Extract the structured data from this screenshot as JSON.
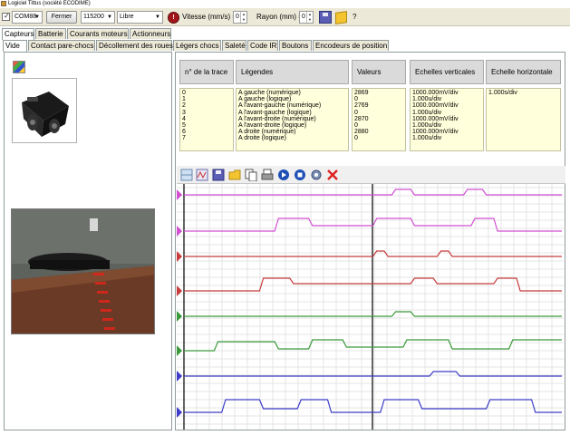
{
  "window": {
    "title": "Logiciel Tittus (société ECODIME)"
  },
  "toolbar": {
    "port": "COM88",
    "close_label": "Fermer",
    "baud": "115200",
    "mode": "Libre",
    "stop_label": "!",
    "speed_label": "Vitesse (mm/s) =",
    "speed_value": "0",
    "radius_label": "Rayon (mm) =",
    "radius_value": "0",
    "help_label": "?"
  },
  "main_tabs": [
    "Capteurs",
    "Batterie",
    "Courants moteurs",
    "Actionneurs"
  ],
  "sub_tabs": [
    "Vide",
    "Contact pare-chocs",
    "Décollement des roues",
    "Légers chocs",
    "Saleté",
    "Code IR",
    "Boutons",
    "Encodeurs de position"
  ],
  "table": {
    "headers": [
      "n° de la trace",
      "Légendes",
      "Valeurs",
      "Echelles verticales",
      "Echelle horizontale"
    ],
    "indices": [
      "0",
      "1",
      "2",
      "3",
      "4",
      "5",
      "6",
      "7"
    ],
    "legends": [
      "A gauche (numérique)",
      "A gauche (logique)",
      "A l'avant-gauche (numérique)",
      "A l'avant-gauche (logique)",
      "A l'avant-droite (numérique)",
      "A l'avant-droite (logique)",
      "A droite (numérique)",
      "A droite (logique)"
    ],
    "values": [
      "2869",
      "0",
      "2769",
      "0",
      "2870",
      "0",
      "2880",
      "0"
    ],
    "vertical_scales": [
      "1000.000mV/div",
      "1.000u/div",
      "1000.000mV/div",
      "1.000u/div",
      "1000.000mV/div",
      "1.000u/div",
      "1000.000mV/div",
      "1.000u/div"
    ],
    "horizontal_scale": "1.000s/div"
  },
  "trace_colors": [
    "#d24fd2",
    "#d24fd2",
    "#c83c3c",
    "#c83c3c",
    "#3a9a3a",
    "#3a9a3a",
    "#3c3cc8",
    "#3c3cc8"
  ],
  "chart_tools": [
    "view-icon",
    "wave-icon",
    "save-icon",
    "open-icon",
    "copy-icon",
    "print-icon",
    "play-icon",
    "stop-icon",
    "settings-icon",
    "delete-icon"
  ]
}
